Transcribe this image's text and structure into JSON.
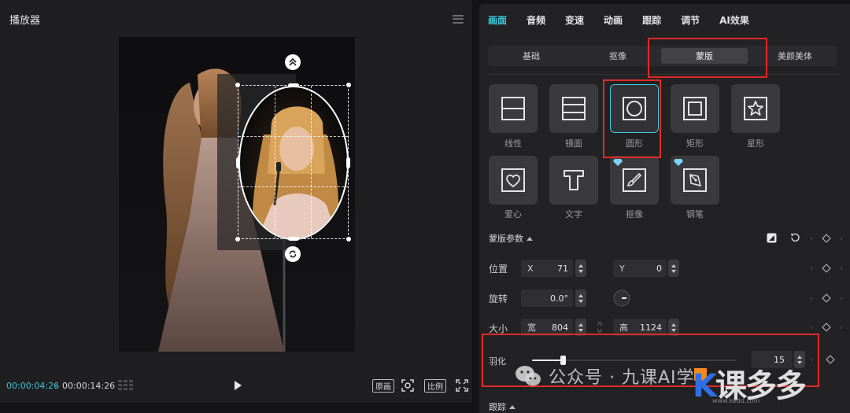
{
  "player": {
    "title": "播放器",
    "time_current": "00:00:04:26",
    "time_separator": "/",
    "time_total": "00:00:14:26",
    "original_label": "原画",
    "ratio_label": "比例"
  },
  "props": {
    "tabs": [
      "画面",
      "音频",
      "变速",
      "动画",
      "跟踪",
      "调节",
      "AI效果"
    ],
    "active_tab": "画面",
    "subtabs": [
      "基础",
      "抠像",
      "蒙版",
      "美颜美体"
    ],
    "active_subtab": "蒙版",
    "masks": [
      {
        "label": "线性",
        "icon": "linear-mask-icon"
      },
      {
        "label": "镜面",
        "icon": "mirror-mask-icon"
      },
      {
        "label": "圆形",
        "icon": "circle-mask-icon"
      },
      {
        "label": "矩形",
        "icon": "rectangle-mask-icon"
      },
      {
        "label": "星形",
        "icon": "star-mask-icon"
      },
      {
        "label": "爱心",
        "icon": "heart-mask-icon"
      },
      {
        "label": "文字",
        "icon": "text-mask-icon"
      },
      {
        "label": "抠像",
        "icon": "brush-mask-icon"
      },
      {
        "label": "钢笔",
        "icon": "pen-mask-icon"
      }
    ],
    "selected_mask": "圆形",
    "section_title": "蒙版参数",
    "position": {
      "label": "位置",
      "x_label": "X",
      "x_value": "71",
      "y_label": "Y",
      "y_value": "0"
    },
    "rotation": {
      "label": "旋转",
      "value": "0.0°"
    },
    "size": {
      "label": "大小",
      "w_label": "宽",
      "w_value": "804",
      "h_label": "高",
      "h_value": "1124"
    },
    "feather": {
      "label": "羽化",
      "value": "15",
      "fraction": 0.15
    },
    "next_section": "跟踪"
  },
  "watermark": {
    "text": "公众号 · 九课AI学",
    "logo_k": "K",
    "logo_rest": "课多多",
    "logo_url": "www.kedd.com"
  },
  "colors": {
    "accent": "#3ccbdb",
    "highlight": "#e02a25"
  }
}
